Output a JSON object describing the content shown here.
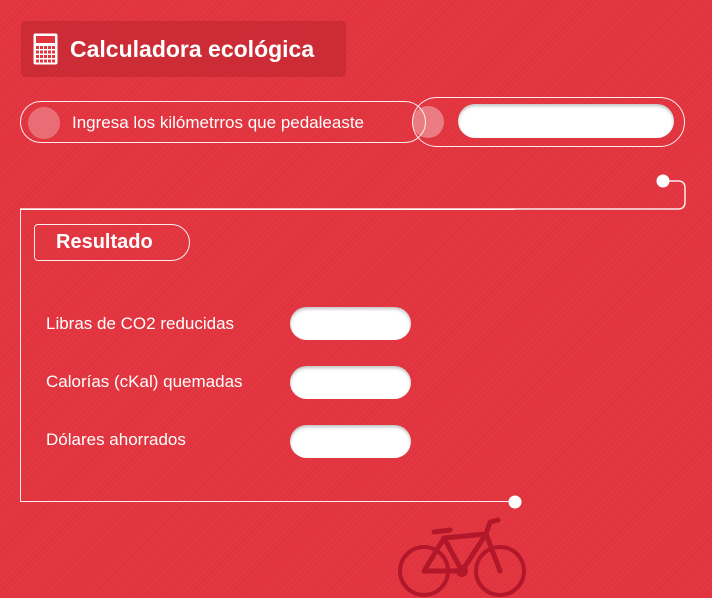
{
  "colors": {
    "background": "#e1343f",
    "accent": "#ffffff",
    "bike": "#b3172a"
  },
  "header": {
    "title": "Calculadora ecológica",
    "icon": "calculator-icon"
  },
  "distance": {
    "label": "Ingresa los kilómetrros que pedaleaste",
    "value": "",
    "placeholder": ""
  },
  "results": {
    "title": "Resultado",
    "rows": [
      {
        "label": "Libras de CO2 reducidas",
        "value": ""
      },
      {
        "label": "Calorías (cKal) quemadas",
        "value": ""
      },
      {
        "label": "Dólares ahorrados",
        "value": ""
      }
    ]
  },
  "decoration": {
    "icon": "bicycle-icon"
  }
}
